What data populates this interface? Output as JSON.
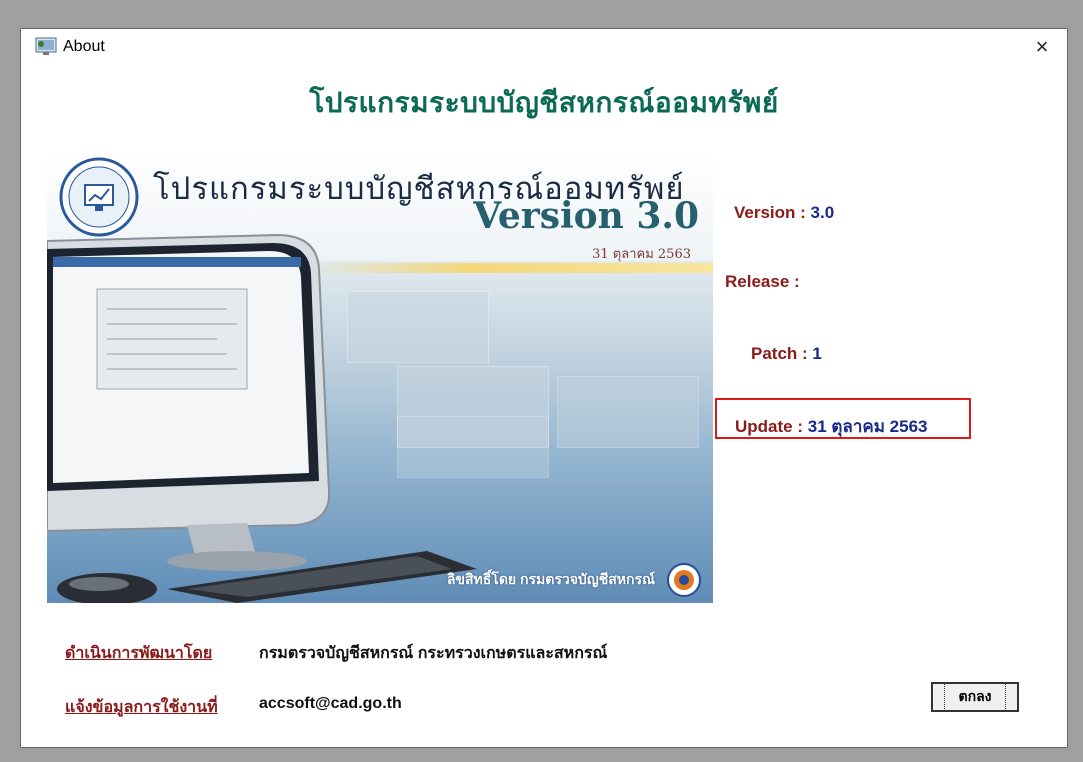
{
  "window": {
    "title": "About",
    "close_glyph": "×",
    "icon": "app-icon"
  },
  "heading": "โปรแกรมระบบบัญชีสหกรณ์ออมทรัพย์",
  "splash": {
    "title": "โปรแกรมระบบบัญชีสหกรณ์ออมทรัพย์",
    "version": "Version 3.0",
    "date": "31 ตุลาคม 2563",
    "footer": "ลิขสิทธิ์โดย กรมตรวจบัญชีสหกรณ์"
  },
  "info": {
    "version_label": "Version : ",
    "version_value": "3.0",
    "release_label": "Release :",
    "release_value": "",
    "patch_label": "Patch : ",
    "patch_value": "1",
    "update_label": "Update : ",
    "update_value": "31 ตุลาคม 2563"
  },
  "footer": {
    "developer_label": "ดำเนินการพัฒนาโดย",
    "developer_value": "กรมตรวจบัญชีสหกรณ์ กระทรวงเกษตรและสหกรณ์",
    "contact_label": "แจ้งข้อมูลการใช้งานที่",
    "contact_value": "accsoft@cad.go.th"
  },
  "buttons": {
    "ok": "ตกลง"
  },
  "colors": {
    "heading": "#0b6a55",
    "label": "#8b1a1a",
    "value": "#1a2a8a",
    "highlight": "#e01818"
  }
}
